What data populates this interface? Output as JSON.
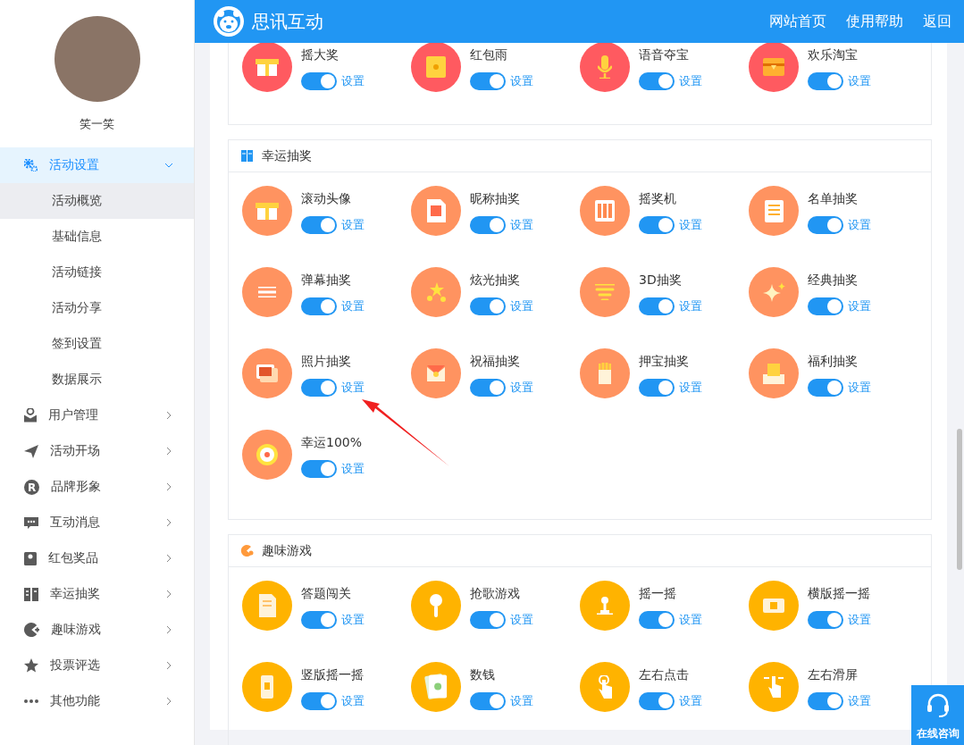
{
  "header": {
    "title": "思讯互动",
    "nav": [
      {
        "label": "网站首页"
      },
      {
        "label": "使用帮助"
      },
      {
        "label": "返回"
      }
    ]
  },
  "sidebar": {
    "user_name": "笑一笑",
    "menu": [
      {
        "label": "活动设置",
        "expanded": true,
        "selected": true,
        "children": [
          {
            "label": "活动概览",
            "selected": true
          },
          {
            "label": "基础信息",
            "selected": false
          },
          {
            "label": "活动链接",
            "selected": false
          },
          {
            "label": "活动分享",
            "selected": false
          },
          {
            "label": "签到设置",
            "selected": false
          },
          {
            "label": "数据展示",
            "selected": false
          }
        ]
      },
      {
        "label": "用户管理",
        "expanded": false,
        "selected": false
      },
      {
        "label": "活动开场",
        "expanded": false,
        "selected": false
      },
      {
        "label": "品牌形象",
        "expanded": false,
        "selected": false,
        "icon": "R"
      },
      {
        "label": "互动消息",
        "expanded": false,
        "selected": false
      },
      {
        "label": "红包奖品",
        "expanded": false,
        "selected": false
      },
      {
        "label": "幸运抽奖",
        "expanded": false,
        "selected": false
      },
      {
        "label": "趣味游戏",
        "expanded": false,
        "selected": false
      },
      {
        "label": "投票评选",
        "expanded": false,
        "selected": false
      },
      {
        "label": "其他功能",
        "expanded": false,
        "selected": false
      }
    ]
  },
  "sections": [
    {
      "color": "#ff5a60",
      "items": [
        {
          "name": "摇大奖",
          "on": true,
          "action": "设置"
        },
        {
          "name": "红包雨",
          "on": true,
          "action": "设置"
        },
        {
          "name": "语音夺宝",
          "on": true,
          "action": "设置"
        },
        {
          "name": "欢乐淘宝",
          "on": true,
          "action": "设置"
        }
      ]
    },
    {
      "title": "幸运抽奖",
      "color": "#ff9360",
      "items": [
        {
          "name": "滚动头像",
          "on": true,
          "action": "设置"
        },
        {
          "name": "昵称抽奖",
          "on": true,
          "action": "设置"
        },
        {
          "name": "摇奖机",
          "on": true,
          "action": "设置"
        },
        {
          "name": "名单抽奖",
          "on": true,
          "action": "设置"
        },
        {
          "name": "弹幕抽奖",
          "on": true,
          "action": "设置"
        },
        {
          "name": "炫光抽奖",
          "on": true,
          "action": "设置"
        },
        {
          "name": "3D抽奖",
          "on": true,
          "action": "设置"
        },
        {
          "name": "经典抽奖",
          "on": true,
          "action": "设置"
        },
        {
          "name": "照片抽奖",
          "on": true,
          "action": "设置"
        },
        {
          "name": "祝福抽奖",
          "on": true,
          "action": "设置"
        },
        {
          "name": "押宝抽奖",
          "on": true,
          "action": "设置"
        },
        {
          "name": "福利抽奖",
          "on": true,
          "action": "设置"
        },
        {
          "name": "幸运100%",
          "on": true,
          "action": "设置"
        }
      ]
    },
    {
      "title": "趣味游戏",
      "color": "#ffb300",
      "items": [
        {
          "name": "答题闯关",
          "on": true,
          "action": "设置"
        },
        {
          "name": "抢歌游戏",
          "on": true,
          "action": "设置"
        },
        {
          "name": "摇一摇",
          "on": true,
          "action": "设置"
        },
        {
          "name": "横版摇一摇",
          "on": true,
          "action": "设置"
        },
        {
          "name": "竖版摇一摇",
          "on": true,
          "action": "设置"
        },
        {
          "name": "数钱",
          "on": true,
          "action": "设置"
        },
        {
          "name": "左右点击",
          "on": true,
          "action": "设置"
        },
        {
          "name": "左右滑屏",
          "on": true,
          "action": "设置"
        }
      ]
    }
  ],
  "consult_button": {
    "label": "在线咨询"
  }
}
